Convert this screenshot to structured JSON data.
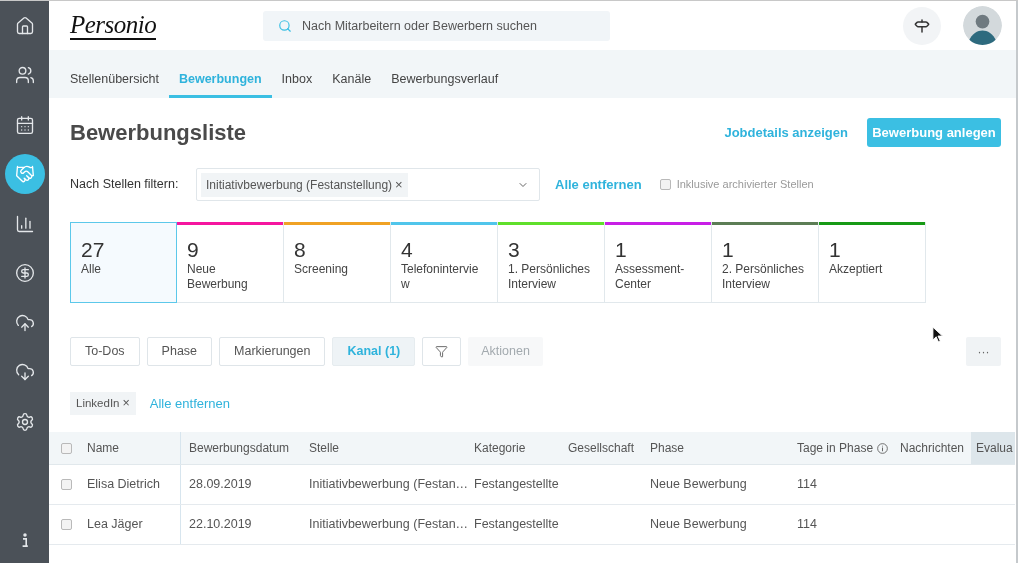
{
  "sidebar": {
    "items": [
      {
        "selected": false
      },
      {
        "selected": false
      },
      {
        "selected": false
      },
      {
        "selected": true
      },
      {
        "selected": false
      },
      {
        "selected": false
      },
      {
        "selected": false
      },
      {
        "selected": false
      },
      {
        "selected": false
      }
    ]
  },
  "header": {
    "logo": "Personio",
    "search": {
      "placeholder": "Nach Mitarbeitern oder Bewerbern suchen"
    }
  },
  "tabs": [
    {
      "label": "Stellenübersicht",
      "selected": false
    },
    {
      "label": "Bewerbungen",
      "selected": true
    },
    {
      "label": "Inbox",
      "selected": false
    },
    {
      "label": "Kanäle",
      "selected": false
    },
    {
      "label": "Bewerbungsverlauf",
      "selected": false
    }
  ],
  "page": {
    "title": "Bewerbungsliste",
    "details_link": "Jobdetails anzeigen",
    "create_button": "Bewerbung anlegen"
  },
  "job_filter": {
    "label": "Nach Stellen filtern:",
    "tags": [
      {
        "label": "Initiativbewerbung (Festanstellung)",
        "remove": "×"
      }
    ],
    "clear_link": "Alle entfernen",
    "archived": {
      "label": "Inklusive archivierter Stellen",
      "checked": false
    }
  },
  "phases": [
    {
      "count": "27",
      "label": "Alle",
      "selected": true
    },
    {
      "count": "9",
      "label": "Neue Bewerbung",
      "selected": false,
      "color": "#f5169f"
    },
    {
      "count": "8",
      "label": "Screening",
      "selected": false,
      "color": "#f0a224"
    },
    {
      "count": "4",
      "label": "Telefoninterview",
      "selected": false,
      "color": "#50c5eb"
    },
    {
      "count": "3",
      "label": "1. Persönliches Interview",
      "selected": false,
      "color": "#5fdf2a"
    },
    {
      "count": "1",
      "label": "Assessment-Center",
      "selected": false,
      "color": "#c81ee6"
    },
    {
      "count": "1",
      "label": "2. Persönliches Interview",
      "selected": false,
      "color": "#5c7d55"
    },
    {
      "count": "1",
      "label": "Akzeptiert",
      "selected": false,
      "color": "#179a15"
    }
  ],
  "toolbar": {
    "filters": [
      {
        "label": "To-Dos",
        "selected": false
      },
      {
        "label": "Phase",
        "selected": false
      },
      {
        "label": "Markierungen",
        "selected": false
      },
      {
        "label": "Kanal (1)",
        "selected": true
      }
    ],
    "actions": {
      "label": "Aktionen",
      "disabled": true
    },
    "more": "···"
  },
  "active_filters": {
    "chips": [
      {
        "label": "LinkedIn",
        "remove": "×"
      }
    ],
    "clear_link": "Alle entfernen"
  },
  "table": {
    "select_all": {
      "checked": false
    },
    "columns": [
      {
        "label": "Name",
        "highlighted": false,
        "info": false
      },
      {
        "label": "Bewerbungsdatum",
        "highlighted": false,
        "info": false
      },
      {
        "label": "Stelle",
        "highlighted": false,
        "info": false
      },
      {
        "label": "Kategorie",
        "highlighted": false,
        "info": false
      },
      {
        "label": "Gesellschaft",
        "highlighted": false,
        "info": false
      },
      {
        "label": "Phase",
        "highlighted": false,
        "info": false
      },
      {
        "label": "Tage in Phase",
        "highlighted": false,
        "info": true
      },
      {
        "label": "Nachrichten",
        "highlighted": false,
        "info": false
      },
      {
        "label": "Evalua",
        "highlighted": true,
        "info": false
      }
    ],
    "rows": [
      {
        "checked": false,
        "name": "Elisa Dietrich",
        "date": "28.09.2019",
        "position": "Initiativbewerbung (Festan…",
        "category": "Festangestellte",
        "phase": "Neue Bewerbung",
        "days_in_phase": "114"
      },
      {
        "checked": false,
        "name": "Lea Jäger",
        "date": "22.10.2019",
        "position": "Initiativbewerbung (Festan…",
        "category": "Festangestellte",
        "phase": "Neue Bewerbung",
        "days_in_phase": "114"
      }
    ]
  }
}
